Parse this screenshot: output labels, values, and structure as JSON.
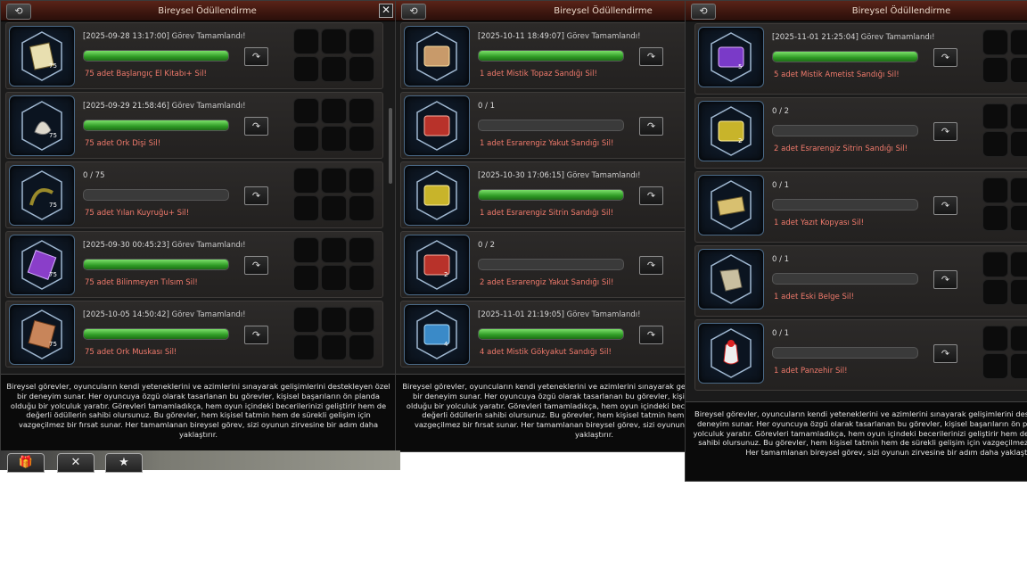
{
  "panels": [
    {
      "title": "Bireysel Ödüllendirme",
      "rows": [
        {
          "header": "[2025-09-28 13:17:00]",
          "status": "Görev Tamamlandı!",
          "progress": 1.0,
          "task": "75 adet Başlangıç El Kitabı+ Sil!",
          "icon": "book-icon",
          "qty": "75"
        },
        {
          "header": "[2025-09-29 21:58:46]",
          "status": "Görev Tamamlandı!",
          "progress": 1.0,
          "task": "75 adet Ork Dişi Sil!",
          "icon": "tooth-icon",
          "qty": "75"
        },
        {
          "header": "0 / 75",
          "status": "",
          "progress": 0.0,
          "task": "75 adet Yılan Kuyruğu+ Sil!",
          "icon": "snake-tail-icon",
          "qty": "75"
        },
        {
          "header": "[2025-09-30 00:45:23]",
          "status": "Görev Tamamlandı!",
          "progress": 1.0,
          "task": "75 adet Bilinmeyen Tılsım Sil!",
          "icon": "talisman-icon",
          "qty": "75"
        },
        {
          "header": "[2025-10-05 14:50:42]",
          "status": "Görev Tamamlandı!",
          "progress": 1.0,
          "task": "75 adet Ork Muskası Sil!",
          "icon": "amulet-scroll-icon",
          "qty": "75"
        }
      ],
      "description": "Bireysel görevler, oyuncuların kendi yeteneklerini ve azimlerini sınayarak gelişimlerini destekleyen özel bir deneyim sunar. Her oyuncuya özgü olarak tasarlanan bu görevler, kişisel başarıların ön planda olduğu bir yolculuk yaratır. Görevleri tamamladıkça, hem oyun içindeki becerilerinizi geliştirir hem de değerli ödüllerin sahibi olursunuz. Bu görevler, hem kişisel tatmin hem de sürekli gelişim için vazgeçilmez bir fırsat sunar. Her tamamlanan bireysel görev, sizi oyunun zirvesine bir adım daha yaklaştırır."
    },
    {
      "title": "Bireysel Ödüllendirme",
      "rows": [
        {
          "header": "[2025-10-11 18:49:07]",
          "status": "Görev Tamamlandı!",
          "progress": 1.0,
          "task": "1 adet Mistik Topaz Sandığı Sil!",
          "icon": "topaz-chest-icon",
          "qty": ""
        },
        {
          "header": "0 / 1",
          "status": "",
          "progress": 0.0,
          "task": "1 adet Esrarengiz Yakut Sandığı Sil!",
          "icon": "ruby-chest-icon",
          "qty": ""
        },
        {
          "header": "[2025-10-30 17:06:15]",
          "status": "Görev Tamamlandı!",
          "progress": 1.0,
          "task": "1 adet Esrarengiz Sitrin Sandığı Sil!",
          "icon": "citrine-chest-icon",
          "qty": ""
        },
        {
          "header": "0 / 2",
          "status": "",
          "progress": 0.0,
          "task": "2 adet Esrarengiz Yakut Sandığı Sil!",
          "icon": "ruby-chest-icon",
          "qty": "2"
        },
        {
          "header": "[2025-11-01 21:19:05]",
          "status": "Görev Tamamlandı!",
          "progress": 1.0,
          "task": "4 adet Mistik Gökyakut Sandığı Sil!",
          "icon": "sapphire-chest-icon",
          "qty": "4"
        }
      ],
      "description": "Bireysel görevler, oyuncuların kendi yeteneklerini ve azimlerini sınayarak gelişimlerini destekleyen özel bir deneyim sunar. Her oyuncuya özgü olarak tasarlanan bu görevler, kişisel başarıların ön planda olduğu bir yolculuk yaratır. Görevleri tamamladıkça, hem oyun içindeki becerilerinizi geliştirir hem de değerli ödüllerin sahibi olursunuz. Bu görevler, hem kişisel tatmin hem de sürekli gelişim için vazgeçilmez bir fırsat sunar. Her tamamlanan bireysel görev, sizi oyunun zirvesine bir adım daha yaklaştırır."
    },
    {
      "title": "Bireysel Ödüllendirme",
      "rows": [
        {
          "header": "[2025-11-01 21:25:04]",
          "status": "Görev Tamamlandı!",
          "progress": 1.0,
          "task": "5 adet Mistik Ametist Sandığı Sil!",
          "icon": "amethyst-chest-icon",
          "qty": "5"
        },
        {
          "header": "0 / 2",
          "status": "",
          "progress": 0.0,
          "task": "2 adet Esrarengiz Sitrin Sandığı Sil!",
          "icon": "citrine-chest-icon",
          "qty": "2"
        },
        {
          "header": "0 / 1",
          "status": "",
          "progress": 0.0,
          "task": "1 adet Yazıt Kopyası Sil!",
          "icon": "inscription-icon",
          "qty": ""
        },
        {
          "header": "0 / 1",
          "status": "",
          "progress": 0.0,
          "task": "1 adet Eski Belge Sil!",
          "icon": "old-document-icon",
          "qty": ""
        },
        {
          "header": "0 / 1",
          "status": "",
          "progress": 0.0,
          "task": "1 adet Panzehir Sil!",
          "icon": "antidote-icon",
          "qty": ""
        }
      ],
      "description": "Bireysel görevler, oyuncuların kendi yeteneklerini ve azimlerini sınayarak gelişimlerini destekleyen özel bir deneyim sunar. Her oyuncuya özgü olarak tasarlanan bu görevler, kişisel başarıların ön planda olduğu bir yolculuk yaratır. Görevleri tamamladıkça, hem oyun içindeki becerilerinizi geliştirir hem de değerli ödüllerin sahibi olursunuz. Bu görevler, hem kişisel tatmin hem de sürekli gelişim için vazgeçilmez bir fırsat sunar. Her tamamlanan bireysel görev, sizi oyunun zirvesine bir adım daha yaklaştırır."
    }
  ],
  "bottom_buttons": [
    {
      "icon": "gift-icon",
      "glyph": "🎁"
    },
    {
      "icon": "close-icon",
      "glyph": "✕"
    },
    {
      "icon": "star-icon",
      "glyph": "★"
    }
  ],
  "colors": {
    "progress_fill": "#2e9a24",
    "task_text": "#f07a6c",
    "title_bar": "#3c160f"
  }
}
